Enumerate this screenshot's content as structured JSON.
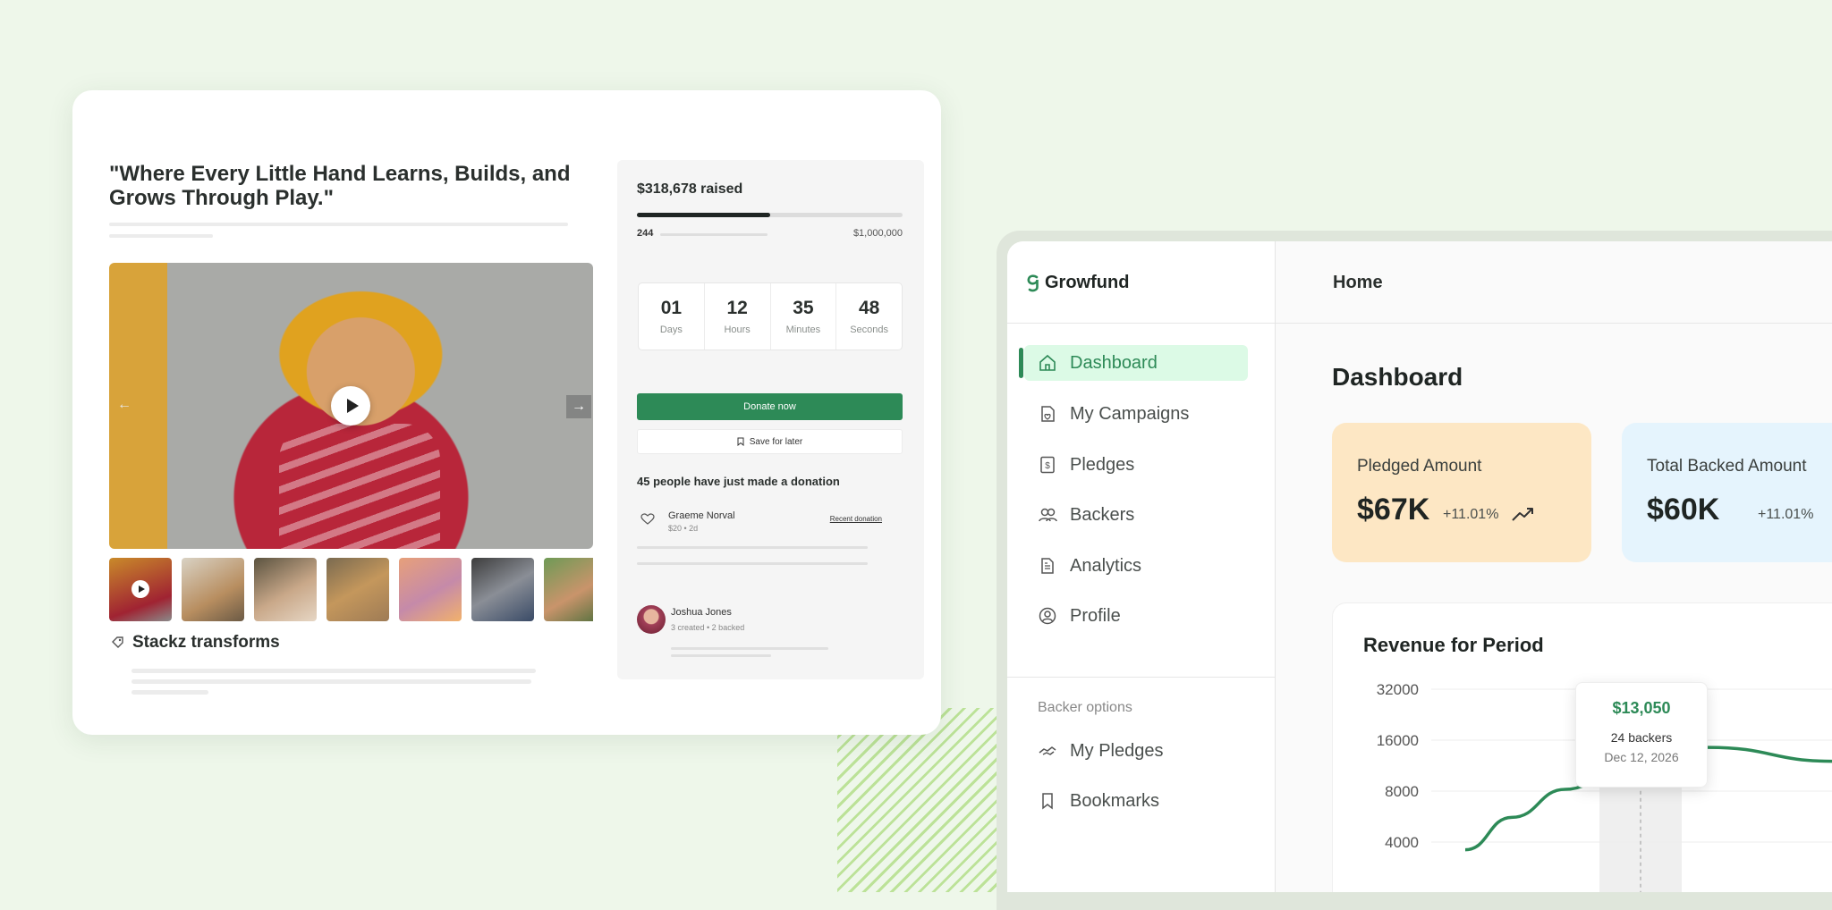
{
  "campaign": {
    "quote": "\"Where Every Little Hand Learns, Builds, and Grows Through Play.\"",
    "tag_label": "Stackz transforms",
    "thumbnails": [
      "child-hood",
      "charity-box",
      "family",
      "group",
      "dancers",
      "students",
      "kids"
    ],
    "progress_fraction": 0.5,
    "donation": {
      "raised_text": "$318,678 raised",
      "backers_count": "244",
      "goal_text": "$1,000,000",
      "countdown": [
        {
          "value": "01",
          "unit": "Days"
        },
        {
          "value": "12",
          "unit": "Hours"
        },
        {
          "value": "35",
          "unit": "Minutes"
        },
        {
          "value": "48",
          "unit": "Seconds"
        }
      ],
      "donate_label": "Donate now",
      "save_label": "Save for later",
      "recent_title": "45 people have just made a donation",
      "donor_name": "Graeme Norval",
      "donor_meta": "$20 • 2d",
      "recent_link": "Recent donation",
      "creator_name": "Joshua Jones",
      "creator_meta": "3 created • 2 backed"
    }
  },
  "dashboard": {
    "brand": "Growfund",
    "topbar_title": "Home",
    "page_title": "Dashboard",
    "nav": [
      {
        "label": "Dashboard",
        "icon": "home-icon",
        "active": true
      },
      {
        "label": "My Campaigns",
        "icon": "campaign-icon"
      },
      {
        "label": "Pledges",
        "icon": "dollar-doc-icon"
      },
      {
        "label": "Backers",
        "icon": "users-icon"
      },
      {
        "label": "Analytics",
        "icon": "document-icon"
      },
      {
        "label": "Profile",
        "icon": "user-circle-icon"
      }
    ],
    "backer_section": "Backer options",
    "backer_nav": [
      {
        "label": "My Pledges",
        "icon": "handshake-icon"
      },
      {
        "label": "Bookmarks",
        "icon": "bookmark-icon"
      }
    ],
    "stats": [
      {
        "label": "Pledged Amount",
        "value": "$67K",
        "change": "+11.01%",
        "color": "#fde7c4"
      },
      {
        "label": "Total Backed Amount",
        "value": "$60K",
        "change": "+11.01%",
        "color": "#e5f4fd"
      }
    ],
    "accent_color": "#2d8a57",
    "chart_data": {
      "type": "line",
      "title": "Revenue for Period",
      "y_ticks": [
        "32000",
        "16000",
        "8000",
        "4000"
      ],
      "series": [
        {
          "values": [
            3600,
            5600,
            8200,
            13050,
            14500,
            12000
          ]
        }
      ],
      "highlight": {
        "value": "$13,050",
        "backers": "24 backers",
        "date": "Dec 12, 2026"
      }
    }
  }
}
